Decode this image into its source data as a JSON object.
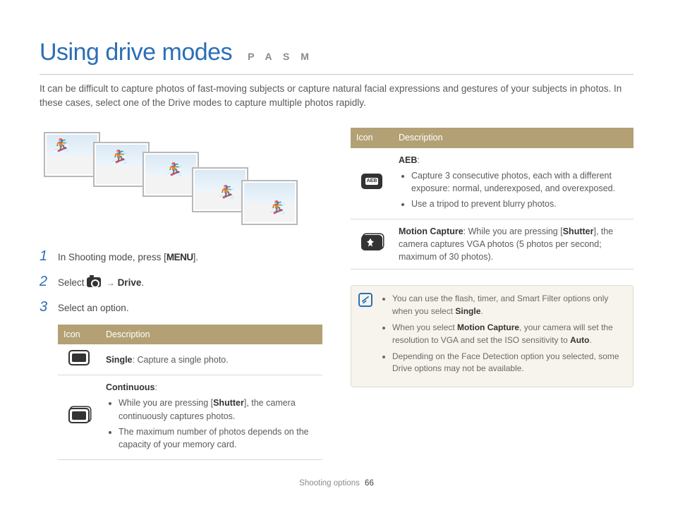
{
  "header": {
    "title": "Using drive modes",
    "pasm": "P A S M"
  },
  "intro": "It can be difficult to capture photos of fast-moving subjects or capture natural facial expressions and gestures of your subjects in photos. In these cases, select one of the Drive modes to capture multiple photos rapidly.",
  "steps": {
    "s1_a": "In Shooting mode, press [",
    "s1_menu": "MENU",
    "s1_b": "].",
    "s2_a": "Select ",
    "s2_arrow": "→",
    "s2_drive": "Drive",
    "s2_b": ".",
    "s3": "Select an option."
  },
  "table_headers": {
    "icon": "Icon",
    "desc": "Description"
  },
  "left_rows": {
    "single_b": "Single",
    "single_t": ": Capture a single photo.",
    "cont_b": "Continuous",
    "cont_t": ":",
    "cont_li1_a": "While you are pressing [",
    "cont_li1_sh": "Shutter",
    "cont_li1_b": "], the camera continuously captures photos.",
    "cont_li2": "The maximum number of photos depends on the capacity of your memory card."
  },
  "right_rows": {
    "aeb_b": "AEB",
    "aeb_t": ":",
    "aeb_li1": "Capture 3 consecutive photos, each with a different exposure: normal, underexposed, and overexposed.",
    "aeb_li2": "Use a tripod to prevent blurry photos.",
    "mc_b": "Motion Capture",
    "mc_t1": ": While you are pressing [",
    "mc_sh": "Shutter",
    "mc_t2": "], the camera captures VGA photos (5 photos per second; maximum of 30 photos)."
  },
  "note": {
    "li1_a": "You can use the flash, timer, and Smart Filter options only when you select ",
    "li1_b": "Single",
    "li1_c": ".",
    "li2_a": "When you select ",
    "li2_b": "Motion Capture",
    "li2_c": ", your camera will set the resolution to VGA and set the ISO sensitivity to ",
    "li2_d": "Auto",
    "li2_e": ".",
    "li3": "Depending on the Face Detection option you selected, some Drive options may not be available."
  },
  "footer": {
    "section": "Shooting options",
    "page": "66"
  }
}
